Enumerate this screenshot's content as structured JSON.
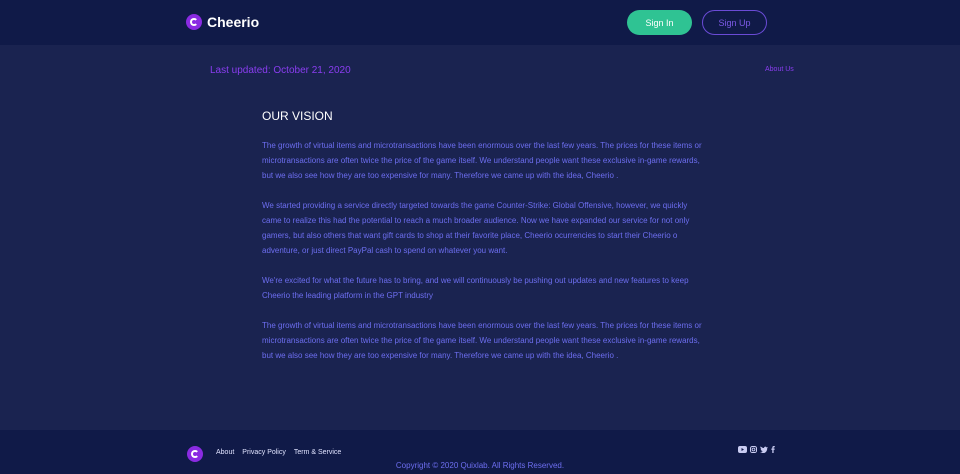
{
  "header": {
    "brand": "Cheerio",
    "signin_label": "Sign In",
    "signup_label": "Sign Up"
  },
  "meta": {
    "last_updated": "Last updated: October 21, 2020",
    "about_link": "About Us"
  },
  "article": {
    "title": "OUR VISION",
    "paragraphs": [
      "The growth of virtual items and microtransactions have been enormous over the last few years. The prices for these items or microtransactions are often twice the price of the game itself. We understand people want these exclusive in-game rewards, but we also see how they are too expensive for many. Therefore we came up with the idea, Cheerio .",
      "We started providing a service directly targeted towards the game Counter-Strike: Global Offensive, however, we quickly came to realize this had the potential to reach a much broader audience. Now we have expanded our service for not only gamers, but also others that want gift cards to shop at their favorite place, Cheerio ocurrencies to start their Cheerio o adventure, or just direct PayPal cash to spend on whatever you want.",
      "We're excited for what the future has to bring, and we will continuously be pushing out updates and new features to keep Cheerio the leading platform in the GPT industry",
      "The growth of virtual items and microtransactions have been enormous over the last few years. The prices for these items or microtransactions are often twice the price of the game itself. We understand people want these exclusive in-game rewards, but we also see how they are too expensive for many. Therefore we came up with the idea, Cheerio ."
    ]
  },
  "footer": {
    "links": [
      "About",
      "Privacy Policy",
      "Term & Service"
    ],
    "copyright": "Copyright © 2020 Quixlab. All Rights Reserved.",
    "social_icons": [
      "youtube-icon",
      "instagram-icon",
      "twitter-icon",
      "facebook-icon"
    ]
  },
  "colors": {
    "background": "#1a2350",
    "header_bg": "#101a48",
    "accent_purple": "#8a2be2",
    "signin_green": "#2fc393",
    "body_text": "#6d6ef0"
  }
}
